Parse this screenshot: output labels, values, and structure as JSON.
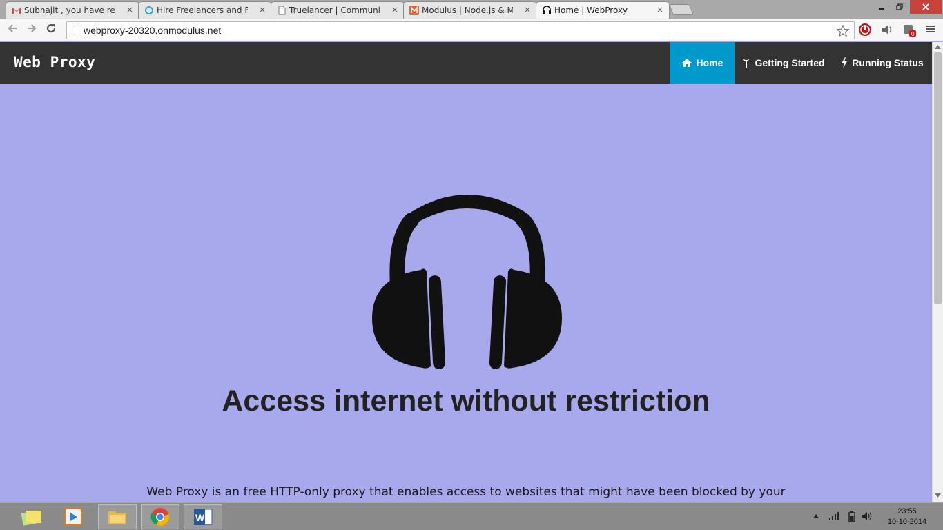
{
  "browser": {
    "tabs": [
      {
        "label": "Subhajit , you have receiv",
        "icon": "gmail-icon"
      },
      {
        "label": "Hire Freelancers and Find",
        "icon": "freelancer-icon"
      },
      {
        "label": "Truelancer | Community c",
        "icon": "page-icon"
      },
      {
        "label": "Modulus | Node.js & Mon",
        "icon": "modulus-icon"
      },
      {
        "label": "Home | WebProxy",
        "icon": "headphones-icon"
      }
    ],
    "tab_close_glyph": "×",
    "url": "webproxy-20320.onmodulus.net"
  },
  "site": {
    "brand": "Web Proxy",
    "nav": [
      {
        "label": "Home",
        "icon": "home-icon",
        "active": true
      },
      {
        "label": "Getting Started",
        "icon": "wrench-icon",
        "active": false
      },
      {
        "label": "Running Status",
        "icon": "bolt-icon",
        "active": false
      }
    ],
    "headline": "Access internet without restriction",
    "description": "Web Proxy is an free HTTP-only proxy that enables access to websites that might have been blocked by your",
    "accent_color": "#0099cc",
    "background_color": "#a8a8ec",
    "navbar_color": "#333333"
  },
  "taskbar": {
    "time": "23:55",
    "date": "10-10-2014"
  }
}
